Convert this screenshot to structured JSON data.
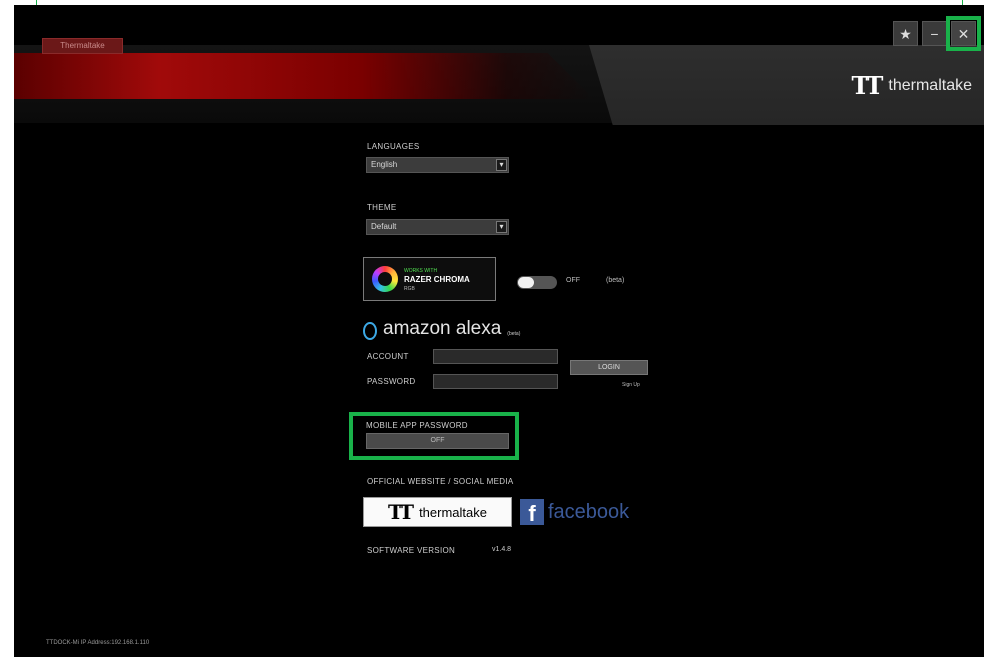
{
  "app": {
    "top_tab": "Thermaltake"
  },
  "brand": {
    "mark": "TT",
    "name": "thermaltake"
  },
  "window_buttons": {
    "pin": "★",
    "minimize": "−",
    "close": "✕"
  },
  "settings": {
    "language_label": "LANGUAGES",
    "language_value": "English",
    "theme_label": "THEME",
    "theme_value": "Default",
    "dropdown_arrow": "▾"
  },
  "chroma": {
    "small": "WORKS WITH",
    "main": "RAZER CHROMA",
    "sub": "RGB",
    "toggle_state": "OFF",
    "extra": "(beta)"
  },
  "alexa": {
    "word": "amazon alexa",
    "beta": "(beta)",
    "account_label": "ACCOUNT",
    "password_label": "PASSWORD",
    "login_label": "LOGIN",
    "signup": "Sign Up"
  },
  "mobile": {
    "label": "MOBILE APP PASSWORD",
    "value": "OFF"
  },
  "official": {
    "label": "OFFICIAL WEBSITE / SOCIAL MEDIA",
    "tt_mark": "TT",
    "tt_name": "thermaltake",
    "fb_f": "f",
    "fb_word": "facebook"
  },
  "version": {
    "label": "SOFTWARE VERSION",
    "value": "v1.4.8"
  },
  "footer": {
    "text": "TTDOCK-Mi IP Address:192.168.1.110"
  },
  "colors": {
    "accent": "#19b24a",
    "brand_red": "#a10a0a",
    "facebook": "#3b5998",
    "alexa": "#3da9e6"
  }
}
